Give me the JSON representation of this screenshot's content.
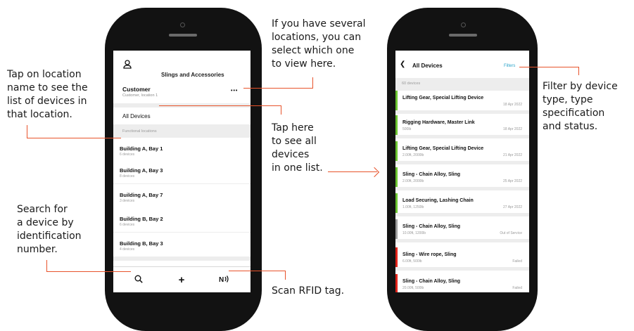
{
  "colors": {
    "accent": "#e8532b",
    "link": "#2aa3c9",
    "ok": "#6cc531",
    "out_of_service": "#9e9e9e",
    "failed": "#e2231a"
  },
  "annotations": {
    "tap_location": [
      "Tap on location",
      "name to see the",
      "list of devices in",
      "that location."
    ],
    "several_locations": [
      "If you have several",
      "locations, you can",
      "select which one",
      "to view here."
    ],
    "tap_here": [
      "Tap here",
      "to see all",
      "devices",
      "in one list."
    ],
    "search": [
      "Search for",
      "a device by",
      "identification",
      "number."
    ],
    "scan": "Scan RFID tag.",
    "filter": [
      "Filter by device",
      "type, type",
      "specification",
      "and status."
    ]
  },
  "left_screen": {
    "user_icon": "user-icon",
    "title": "Slings and Accessories",
    "customer": "Customer",
    "customer_location": "Customer, location 1",
    "more": "•••",
    "all_devices": "All Devices",
    "section_label": "Functional locations",
    "locations": [
      {
        "name": "Building A, Bay 1",
        "count": "6 devices"
      },
      {
        "name": "Building A, Bay 3",
        "count": "8 devices"
      },
      {
        "name": "Building A, Bay 7",
        "count": "3 devices"
      },
      {
        "name": "Building B, Bay 2",
        "count": "6 devices"
      },
      {
        "name": "Building B, Bay 3",
        "count": "4 devices"
      }
    ],
    "tabs": {
      "search_icon": "search-icon",
      "add": "+",
      "rfid_icon": "rfid-icon"
    }
  },
  "right_screen": {
    "back": "❮",
    "title": "All Devices",
    "filters": "Filters",
    "count": "60 devices",
    "devices": [
      {
        "name": "Lifting Gear, Special Lifting Device",
        "spec": "",
        "status": "18 Apr 2022",
        "state": "ok"
      },
      {
        "name": "Rigging Hardware, Master Link",
        "spec": "500lb",
        "status": "18 Apr 2022",
        "state": "ok"
      },
      {
        "name": "Lifting Gear, Special Lifting Device",
        "spec": "2.00ft, 2000lb",
        "status": "21 Apr 2022",
        "state": "ok"
      },
      {
        "name": "Sling - Chain Alloy, Sling",
        "spec": "2.00ft, 2000lb",
        "status": "25 Apr 2022",
        "state": "ok"
      },
      {
        "name": "Load Securing, Lashing Chain",
        "spec": "1.00ft, 1250lb",
        "status": "27 Apr 2022",
        "state": "ok"
      },
      {
        "name": "Sling - Chain Alloy, Sling",
        "spec": "10.00ft, 1200lb",
        "status": "Out of Service",
        "state": "out_of_service"
      },
      {
        "name": "Sling - Wire rope, Sling",
        "spec": "6.00ft, 500lb",
        "status": "Failed",
        "state": "failed"
      },
      {
        "name": "Sling - Chain Alloy, Sling",
        "spec": "20.00ft, 500lb",
        "status": "Failed",
        "state": "failed"
      }
    ]
  }
}
